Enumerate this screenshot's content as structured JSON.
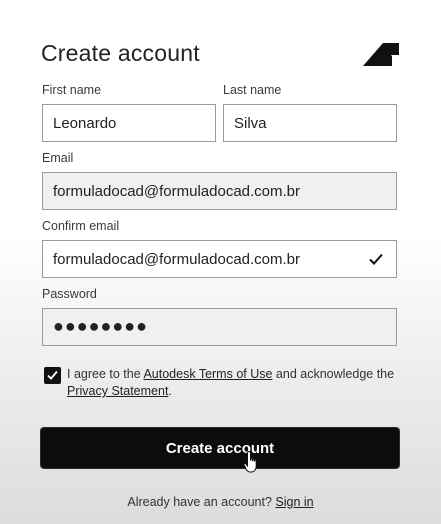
{
  "form": {
    "title": "Create account",
    "first_name": {
      "label": "First name",
      "value": "Leonardo"
    },
    "last_name": {
      "label": "Last name",
      "value": "Silva"
    },
    "email": {
      "label": "Email",
      "value": "formuladocad@formuladocad.com.br"
    },
    "confirm_email": {
      "label": "Confirm email",
      "value": "formuladocad@formuladocad.com.br",
      "validated": true
    },
    "password": {
      "label": "Password",
      "masked_value": "●●●●●●●●"
    },
    "agreement": {
      "checked": true,
      "text_1": "I agree to the ",
      "terms_link": "Autodesk Terms of Use",
      "text_2": " and acknowledge the ",
      "privacy_link": "Privacy Statement",
      "text_3": "."
    },
    "submit_label": "Create account",
    "signin_prompt": "Already have an account? ",
    "signin_link": "Sign in"
  },
  "icons": {
    "logo": "autodesk-logo-icon",
    "check": "checkmark-icon",
    "checkbox": "checkbox-checked-icon",
    "cursor": "hand-pointer-icon"
  },
  "colors": {
    "button_bg": "#0c0c0c",
    "field_border": "#9a9a9a",
    "field_filled_bg": "#f0f0f0"
  }
}
